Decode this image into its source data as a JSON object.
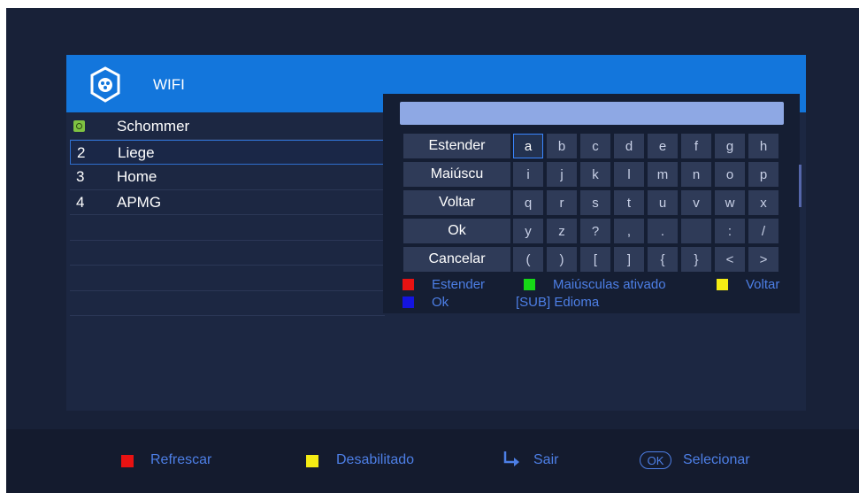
{
  "colors": {
    "red": "#e81212",
    "green": "#16d916",
    "yellow": "#f4ec14",
    "blue": "#1414e0",
    "accent": "#4d7fe6",
    "header": "#1376dc"
  },
  "panel": {
    "title": "WIFI",
    "logo_icon": "wifi-app-logo-icon"
  },
  "networks": [
    {
      "num": "",
      "name": "Schommer",
      "connected": true
    },
    {
      "num": "2",
      "name": "Liege",
      "selected": true
    },
    {
      "num": "3",
      "name": "Home"
    },
    {
      "num": "4",
      "name": "APMG"
    }
  ],
  "keyboard": {
    "input_value": "",
    "actions": [
      "Estender",
      "Maiúscu",
      "Voltar",
      "Ok",
      "Cancelar"
    ],
    "keys": [
      [
        "a",
        "b",
        "c",
        "d",
        "e",
        "f",
        "g",
        "h"
      ],
      [
        "i",
        "j",
        "k",
        "l",
        "m",
        "n",
        "o",
        "p"
      ],
      [
        "q",
        "r",
        "s",
        "t",
        "u",
        "v",
        "w",
        "x"
      ],
      [
        "y",
        "z",
        "?",
        ",",
        ".",
        "",
        ":",
        "/"
      ],
      [
        "(",
        ")",
        "[",
        "]",
        "{",
        "}",
        "<",
        ">"
      ]
    ],
    "legend": {
      "red": "Estender",
      "green": "Maiúsculas ativado",
      "yellow": "Voltar",
      "blue": "Ok",
      "sub": "[SUB]  Edioma"
    }
  },
  "footer": {
    "refresh": "Refrescar",
    "disabled": "Desabilitado",
    "exit": "Sair",
    "ok_badge": "OK",
    "select": "Selecionar"
  }
}
